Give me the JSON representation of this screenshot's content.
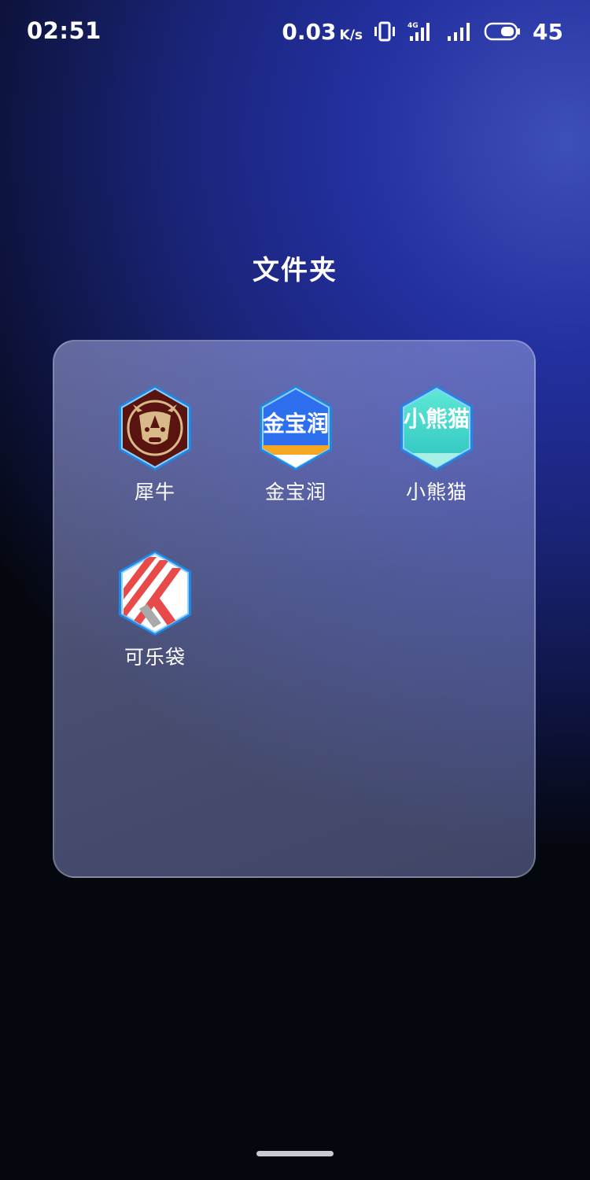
{
  "status_bar": {
    "time": "02:51",
    "net_speed": "0.03",
    "net_speed_unit": "K/s",
    "network_type": "4G",
    "battery_level": "45"
  },
  "folder": {
    "title": "文件夹",
    "apps": [
      {
        "label": "犀牛",
        "icon": "rhino-icon"
      },
      {
        "label": "金宝润",
        "icon": "jinbaorun-icon",
        "icon_text": "金宝润"
      },
      {
        "label": "小熊猫",
        "icon": "xiaoxiongmao-icon",
        "icon_text": "小熊猫"
      },
      {
        "label": "可乐袋",
        "icon": "keledai-icon"
      }
    ]
  },
  "colors": {
    "accent_blue": "#2f7de6",
    "hex_border": "#1e88e5",
    "rhino_bg": "#5a1410",
    "rhino_gold": "#d9b98a",
    "jinbaorun_bg": "#2e6ff0",
    "jinbaorun_stripe": "#f5a623",
    "xiaoxiongmao_bg": "#3ed6c8",
    "keledai_red": "#e84a4a"
  }
}
